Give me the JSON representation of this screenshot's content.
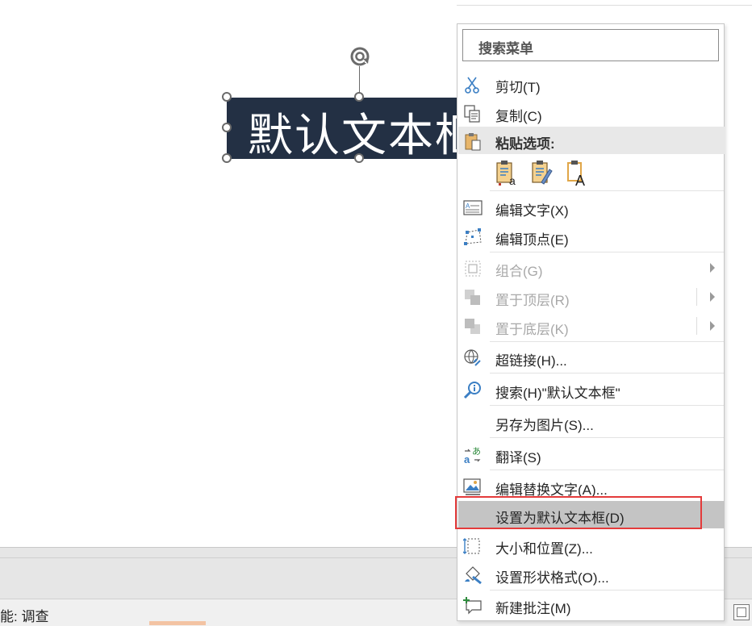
{
  "slide": {
    "textbox_text": "默认文本框"
  },
  "status": {
    "text": "能: 调查"
  },
  "menu": {
    "search_placeholder": "搜索菜单",
    "items": [
      {
        "label": "剪切(T)",
        "icon": "scissors-icon",
        "enabled": true
      },
      {
        "label": "复制(C)",
        "icon": "copy-icon",
        "enabled": true
      },
      {
        "label": "粘贴选项:",
        "icon": "paste-icon",
        "enabled": true,
        "header": true
      },
      {
        "label": "编辑文字(X)",
        "icon": "edit-text-icon",
        "enabled": true
      },
      {
        "label": "编辑顶点(E)",
        "icon": "edit-points-icon",
        "enabled": true
      },
      {
        "label": "组合(G)",
        "icon": "group-icon",
        "enabled": false,
        "submenu": true
      },
      {
        "label": "置于顶层(R)",
        "icon": "bring-to-front-icon",
        "enabled": false,
        "submenu": true
      },
      {
        "label": "置于底层(K)",
        "icon": "send-to-back-icon",
        "enabled": false,
        "submenu": true
      },
      {
        "label": "超链接(H)...",
        "icon": "hyperlink-icon",
        "enabled": true
      },
      {
        "label": "搜索(H)\"默认文本框\"",
        "icon": "smart-lookup-icon",
        "enabled": true
      },
      {
        "label": "另存为图片(S)...",
        "icon": "",
        "enabled": true
      },
      {
        "label": "翻译(S)",
        "icon": "translate-icon",
        "enabled": true
      },
      {
        "label": "编辑替换文字(A)...",
        "icon": "alt-text-icon",
        "enabled": true
      },
      {
        "label": "设置为默认文本框(D)",
        "icon": "",
        "enabled": true,
        "highlighted": true
      },
      {
        "label": "大小和位置(Z)...",
        "icon": "size-position-icon",
        "enabled": true
      },
      {
        "label": "设置形状格式(O)...",
        "icon": "format-shape-icon",
        "enabled": true
      },
      {
        "label": "新建批注(M)",
        "icon": "new-comment-icon",
        "enabled": true
      }
    ],
    "paste_options": [
      {
        "name": "keep-text-only-paste-icon",
        "glyph": "a"
      },
      {
        "name": "picture-paste-icon",
        "glyph": ""
      },
      {
        "name": "text-only-paste-icon",
        "glyph": "A"
      }
    ]
  },
  "colors": {
    "textbox_fill": "#233044",
    "highlight": "#c4c4c4",
    "annotation_border": "#e43b3b"
  }
}
